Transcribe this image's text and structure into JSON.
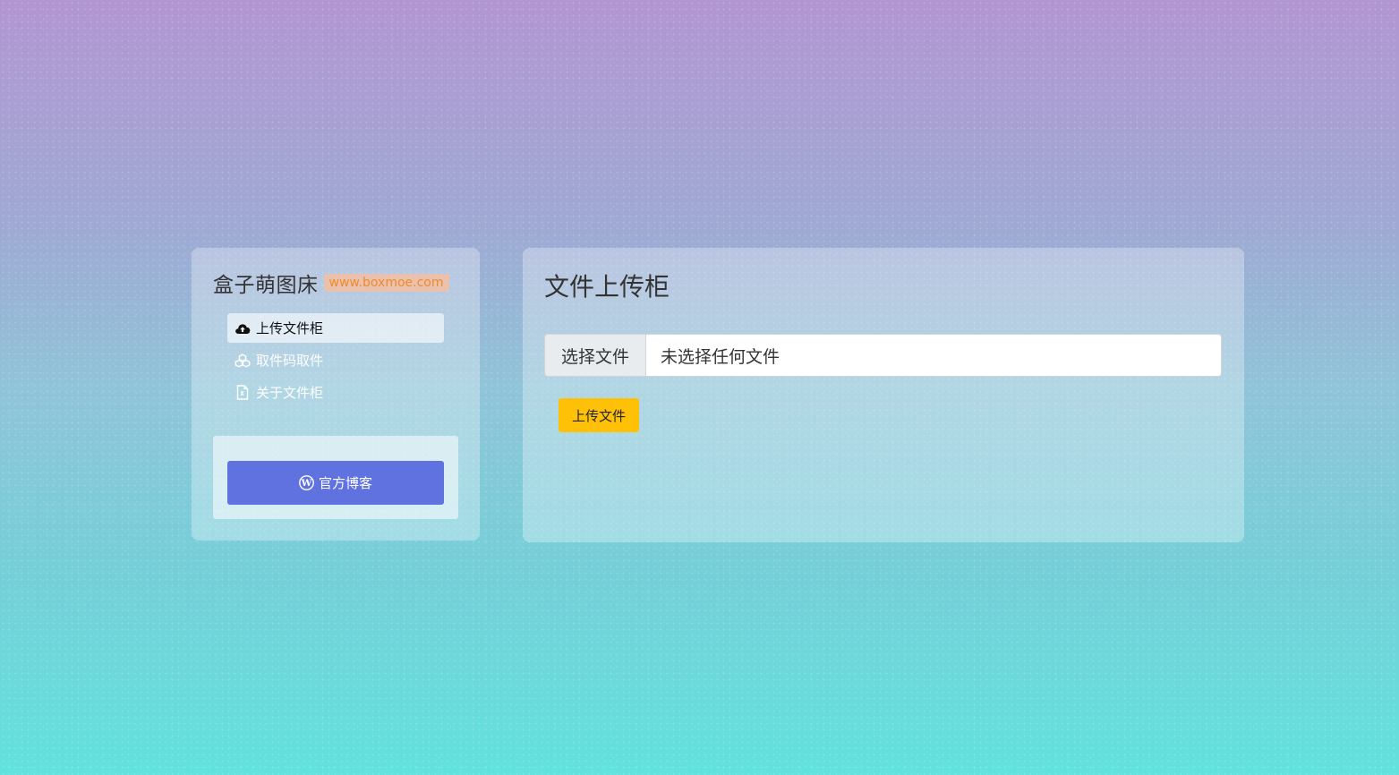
{
  "brand": {
    "title": "盒子萌图床",
    "url": "www.boxmoe.com"
  },
  "menu": {
    "items": [
      {
        "label": "上传文件柜",
        "icon": "cloud-upload-icon",
        "active": true
      },
      {
        "label": "取件码取件",
        "icon": "cubes-icon",
        "active": false
      },
      {
        "label": "关于文件柜",
        "icon": "file-icon",
        "active": false
      }
    ]
  },
  "blog": {
    "label": "官方博客",
    "icon": "wordpress-icon"
  },
  "main": {
    "title": "文件上传柜",
    "file_button": "选择文件",
    "file_status": "未选择任何文件",
    "upload_label": "上传文件"
  },
  "colors": {
    "blog_button": "#5f72e0",
    "upload_button": "#ffc107",
    "brand_url": "#f08a2c"
  }
}
